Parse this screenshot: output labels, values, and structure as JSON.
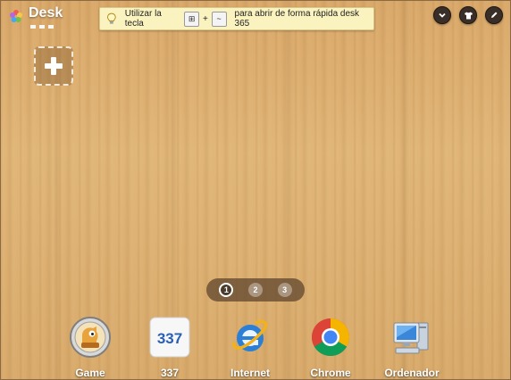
{
  "app": {
    "title": "Desk"
  },
  "tip": {
    "text_before": "Utilizar la tecla",
    "key1": "⊞",
    "plus": "+",
    "key2": "~",
    "text_after": "para abrir de forma rápida desk 365"
  },
  "toolbar": {
    "icons": [
      "chevron-down-icon",
      "shirt-icon",
      "pencil-icon"
    ]
  },
  "pager": {
    "pages": [
      "1",
      "2",
      "3"
    ],
    "active_page": 1
  },
  "dock": {
    "items": [
      {
        "label": "Game",
        "icon": "game-icon"
      },
      {
        "label": "337",
        "icon": "337-icon",
        "icon_text": "337"
      },
      {
        "label": "Internet",
        "icon": "internet-explorer-icon"
      },
      {
        "label": "Chrome",
        "icon": "chrome-icon"
      },
      {
        "label": "Ordenador",
        "icon": "computer-icon"
      }
    ]
  },
  "colors": {
    "wood": "#dcae70",
    "tip_bg": "#fbf3bf",
    "blue_337": "#2a5fb4"
  }
}
